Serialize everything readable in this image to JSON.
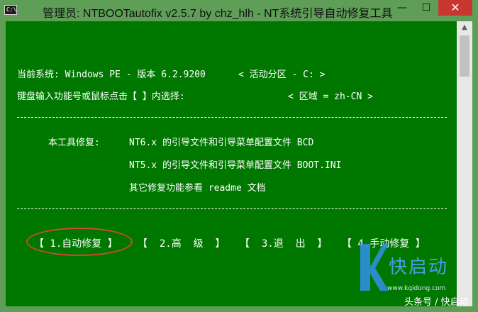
{
  "window": {
    "title": "管理员:  NTBOOTautofix v2.5.7 by chz_hlh - NT系统引导自动修复工具",
    "icon_label": "C:\\",
    "controls": {
      "minimize": "—",
      "maximize": "☐",
      "close": "✕"
    }
  },
  "console": {
    "line1_left": "当前系统: Windows PE - 版本 6.2.9200",
    "line1_right": "< 活动分区 - C: >",
    "line2_left": "键盘输入功能号或鼠标点击【 】内选择:",
    "line2_right": "< 区域 = zh-CN >",
    "repair_label": "本工具修复:",
    "repair_item1": "NT6.x 的引导文件和引导菜单配置文件 BCD",
    "repair_item2": "NT5.x 的引导文件和引导菜单配置文件 BOOT.INI",
    "repair_item3": "其它修复功能参看 readme 文档"
  },
  "menu": [
    {
      "label": "【 1.自动修复 】"
    },
    {
      "label": "【  2.高  级  】"
    },
    {
      "label": "【  3.退  出  】"
    },
    {
      "label": "【 4.手动修复 】"
    }
  ],
  "watermark": {
    "brand": "快启动",
    "url": "www.kqidong.com",
    "caption": "头条号 / 快启动"
  },
  "colors": {
    "console_bg": "#007800",
    "titlebar_bg": "#5e9e57",
    "highlight": "#d8452f",
    "close_button": "#c7372f"
  }
}
